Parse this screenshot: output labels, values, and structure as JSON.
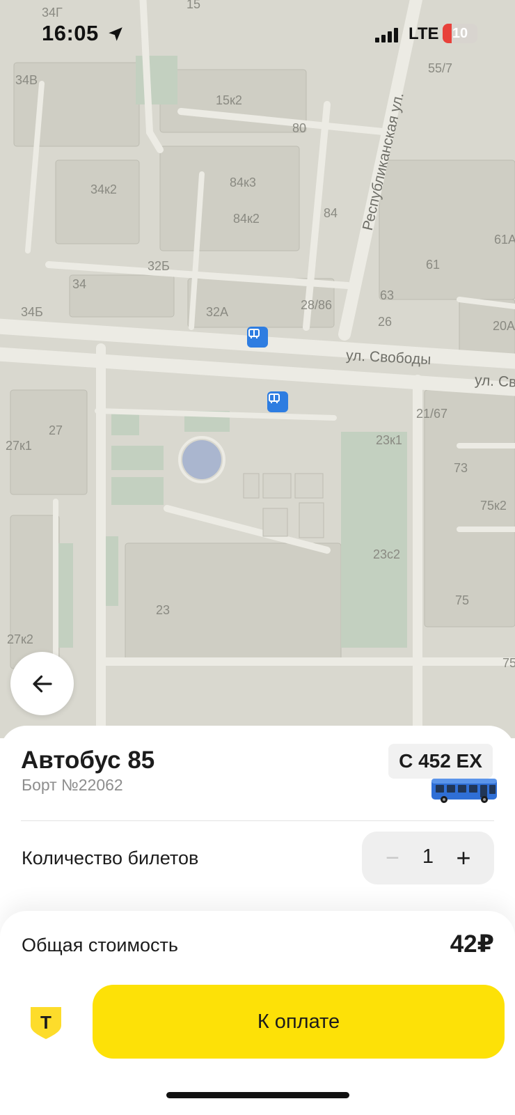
{
  "status_bar": {
    "time": "16:05",
    "network": "LTE",
    "battery_level": "10",
    "battery_color": "#e8413a",
    "icons": [
      "location-arrow-icon",
      "signal-icon",
      "battery-icon"
    ]
  },
  "map": {
    "street_labels": [
      "Республиканская ул.",
      "ул. Свободы",
      "ул. Св"
    ],
    "house_numbers": [
      "34Г",
      "15",
      "34В",
      "15к2",
      "80",
      "55/7",
      "34к2",
      "84к3",
      "84к2",
      "84",
      "61А",
      "61",
      "32Б",
      "34",
      "28/86",
      "63",
      "34Б",
      "32А",
      "26",
      "20А",
      "27",
      "21/67",
      "27к1",
      "23к1",
      "73",
      "75к2",
      "23с2",
      "23",
      "75",
      "27к2",
      "75"
    ],
    "stop_icon": "bus-stop-icon",
    "stop_color": "#2e7de1"
  },
  "back_button": {
    "icon": "arrow-left-icon"
  },
  "ticket": {
    "title": "Автобус 85",
    "board_number": "Борт №22062",
    "plate": "С 452 ЕХ",
    "vehicle_image": "bus-image",
    "quantity_label": "Количество билетов",
    "quantity": "1",
    "minus_label": "−",
    "plus_label": "+"
  },
  "payment": {
    "total_label": "Общая стоимость",
    "total_value": "42₽",
    "pay_button_label": "К оплате",
    "pay_button_color": "#fde107",
    "bank_logo": "bank-shield-logo",
    "bank_logo_letter": "Т"
  }
}
